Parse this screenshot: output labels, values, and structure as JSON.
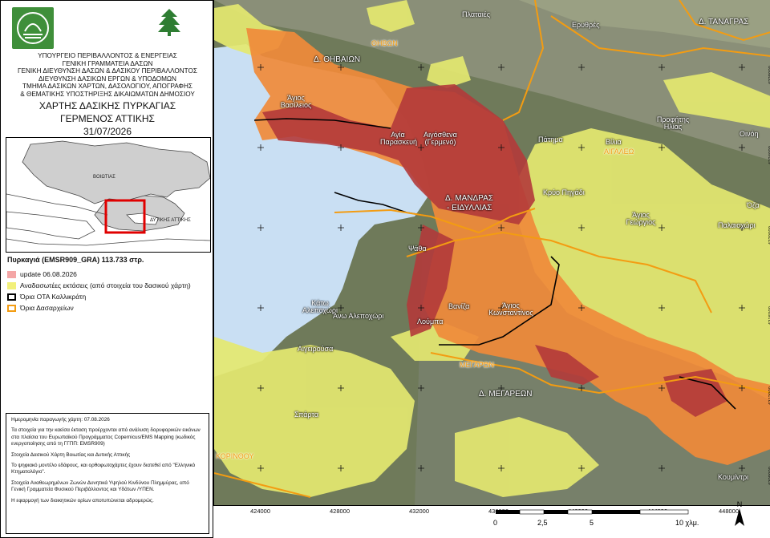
{
  "header": {
    "lines": [
      "ΥΠΟΥΡΓΕΙΟ ΠΕΡΙΒΑΛΛΟΝΤΟΣ & ΕΝΕΡΓΕΙΑΣ",
      "ΓΕΝΙΚΗ ΓΡΑΜΜΑΤΕΙΑ ΔΑΣΩΝ",
      "ΓΕΝΙΚΗ ΔΙΕΥΘΥΝΣΗ ΔΑΣΩΝ & ΔΑΣΙΚΟΥ ΠΕΡΙΒΑΛΛΟΝΤΟΣ",
      "ΔΙΕΥΘΥΝΣΗ ΔΑΣΙΚΩΝ ΕΡΓΩΝ & ΥΠΟΔΟΜΩΝ",
      "ΤΜΗΜΑ ΔΑΣΙΚΩΝ ΧΑΡΤΩΝ, ΔΑΣΟΛΟΓΙΟΥ, ΑΠΟΓΡΑΦΗΣ",
      "& ΘΕΜΑΤΙΚΗΣ ΥΠΟΣΤΗΡΙΞΗΣ ΔΙΚΑΙΩΜΑΤΩΝ ΔΗΜΟΣΙΟΥ"
    ],
    "title1": "ΧΑΡΤΗΣ ΔΑΣΙΚΗΣ ΠΥΡΚΑΓΙΑΣ",
    "title2": "ΓΕΡΜΕΝΟΣ ΑΤΤΙΚΗΣ",
    "date": "31/07/2026"
  },
  "inset": {
    "label_boiotia": "ΒΟΙΩΤΙΑΣ",
    "label_attiki": "ΔΥΤΙΚΗΣ ΑΤΤΙΚΗΣ"
  },
  "legend": {
    "title": "Πυρκαγιά (EMSR909_GRA)  113.733 στρ.",
    "items": [
      {
        "label": "update 06.08.2026",
        "color": "#f4a6a6"
      },
      {
        "label": "Αναδασωτέες εκτάσεις (από στοιχεία του δασικού χάρτη)",
        "color": "#f2f07a"
      },
      {
        "label": "Όρια ΟΤΑ Καλλικράτη",
        "color": "#000000"
      },
      {
        "label": "Όρια Δασαρχείων",
        "color": "#f39c12"
      }
    ]
  },
  "info": {
    "production_date": "Ημερομηνία παραγωγής χάρτη: 07.08.2026",
    "p1": "Τα στοιχεία για την καείσα έκταση προέρχονται από ανάλυση δορυφορικών εικόνων στα πλαίσια του Ευρωπαϊκού Προγράμματος Copernicus/EMS Mapping (κωδικός ενεργοποίησης από τη ΓΓΠΠ: EMSR909)",
    "p2": "Στοιχεία Δασικού Χάρτη Βοιωτίας και Δυτικής Αττικής",
    "p3": "Το ψηφιακό μοντέλο εδάφους, και ορθοφωτοχάρτες έχουν διατεθεί από \"Ελληνικό Κτηματολόγιο\".",
    "p4": "Στοιχεία Αναθεωρημένων Ζωνών Δυνητικά Υψηλού Κινδύνου Πλημμύρας, από Γενική Γραμματεία Φυσικού Περιβάλλοντος και Υδάτων /ΥΠΕΝ.",
    "p5": "Η εφαρμογή των διοικητικών ορίων αποτυπώνεται αδρομερώς."
  },
  "map": {
    "municipalities": {
      "thivaion": "Δ. ΘΗΒΑΙΩΝ",
      "tanagras": "Δ. ΤΑΝΑΓΡΑΣ",
      "mandras": "Δ. ΜΑΝΔΡΑΣ",
      "eidyllias": "- ΕΙΔΥΛΛΙΑΣ",
      "megareon": "Δ. ΜΕΓΑΡΕΩΝ"
    },
    "forest_offices": {
      "thivon": "ΘΗΒΩΝ",
      "aigaleo": "ΑΙΓΑΛΕΩ",
      "megaron": "ΜΕΓΑΡΩΝ",
      "korinthou": "ΚΟΡΙΝΘΟΥ"
    },
    "places": [
      {
        "id": "plataies",
        "name": "Πλαταιές"
      },
      {
        "id": "erythres",
        "name": "Ερυθρές"
      },
      {
        "id": "agios-vasileios",
        "name": "Άγιος Βασίλειος"
      },
      {
        "id": "agia-paraskevi",
        "name": "Αγία Παρασκευή"
      },
      {
        "id": "aigosthena",
        "name": "Αιγόσθενα (Γερμενό)"
      },
      {
        "id": "patima",
        "name": "Πάτημα"
      },
      {
        "id": "vilia",
        "name": "Βίλια"
      },
      {
        "id": "profitis-ilias",
        "name": "Προφήτης Ηλίας"
      },
      {
        "id": "oinoi",
        "name": "Οινόη"
      },
      {
        "id": "kryo-pigadi",
        "name": "Κρύο Πηγάδι"
      },
      {
        "id": "agios-georgios",
        "name": "Άγιος Γεώργιος"
      },
      {
        "id": "palaiochori",
        "name": "Παλαιοχώρι"
      },
      {
        "id": "oza",
        "name": "Όζα"
      },
      {
        "id": "psatha",
        "name": "Ψάθα"
      },
      {
        "id": "kato-alepochori",
        "name": "Κάτω Αλεποχώρι"
      },
      {
        "id": "ano-alepochori",
        "name": "Άνω Αλεποχώρι"
      },
      {
        "id": "vaniza",
        "name": "Βανίζα"
      },
      {
        "id": "agios-konstantinos",
        "name": "Άγιος Κωνσταντίνος"
      },
      {
        "id": "loumpa",
        "name": "Λούμπα"
      },
      {
        "id": "aigeirousa",
        "name": "Αιγειρούσα"
      },
      {
        "id": "sparta",
        "name": "Σπάρτα"
      },
      {
        "id": "koumintri",
        "name": "Κουμίντρι"
      }
    ],
    "x_ticks": [
      "424000",
      "428000",
      "432000",
      "436000",
      "440000",
      "444000",
      "448000"
    ],
    "y_ticks": [
      "4228000",
      "4224000",
      "4220000",
      "4216000",
      "4212000",
      "4208000"
    ]
  },
  "scalebar": {
    "labels": [
      "0",
      "2,5",
      "5",
      "10 χλμ."
    ]
  },
  "north": "N",
  "colors": {
    "burn": "#b23a3a",
    "burn_update": "#f08a3a",
    "reforest": "#e4e870",
    "water": "#c9dff3",
    "boundary_ota": "#000000",
    "boundary_forest": "#f39c12"
  }
}
